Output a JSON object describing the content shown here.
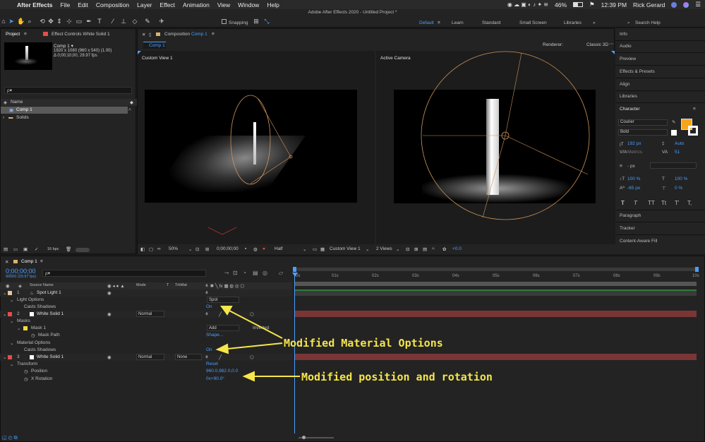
{
  "menubar": {
    "app_name": "After Effects",
    "items": [
      "File",
      "Edit",
      "Composition",
      "Layer",
      "Effect",
      "Animation",
      "View",
      "Window",
      "Help"
    ],
    "battery": "46%",
    "time": "12:39 PM",
    "user": "Rick Gerard"
  },
  "window_title": "Adobe After Effects 2020 - Untitled Project *",
  "toolbar": {
    "snapping_label": "Snapping",
    "workspaces": [
      "Default",
      "Learn",
      "Standard",
      "Small Screen",
      "Libraries"
    ],
    "active_workspace": "Default",
    "search_placeholder": "Search Help"
  },
  "project_panel": {
    "tab_project": "Project",
    "tab_effect_controls": "Effect Controls White Solid 1",
    "comp_name": "Comp 1 ▾",
    "comp_info_1": "1920 x 1080  (960 x 540) (1.00)",
    "comp_info_2": "Δ 0;00;10;00, 29.97 fps",
    "search_icon": "ρ▾",
    "col_name": "Name",
    "items": [
      "Comp 1",
      "Solids"
    ],
    "bpc": "16 bpc"
  },
  "comp_panel": {
    "tab": "Composition Comp 1",
    "tab_prefix": "Composition",
    "tab_comp": "Comp 1",
    "subtab": "Comp 1",
    "renderer_label": "Renderer:",
    "renderer_value": "Classic 3D",
    "view_left": "Custom View 1",
    "view_right": "Active Camera",
    "zoom": "50%",
    "timecode": "0;00;00;00",
    "resolution": "Half",
    "view_select": "Custom View 1",
    "views_count": "2 Views",
    "exposure": "+0.0"
  },
  "right_panel": {
    "items": [
      "Info",
      "Audio",
      "Preview",
      "Effects & Presets",
      "Align",
      "Libraries"
    ],
    "character_title": "Character",
    "font_family": "Courier",
    "font_style": "Bold",
    "font_size": "192 px",
    "leading": "Auto",
    "kerning": "Metrics",
    "tracking": "51",
    "stroke": "- px",
    "vscale": "100 %",
    "hscale": "100 %",
    "baseline": "-65 px",
    "tsume": "0 %",
    "text_styles": [
      "T",
      "T",
      "TT",
      "Tt",
      "T'",
      "T,"
    ],
    "bottom_items": [
      "Paragraph",
      "Tracker",
      "Content-Aware Fill"
    ],
    "fill_color": "#f7a51b"
  },
  "timeline": {
    "tab": "Comp 1",
    "timecode": "0;00;00;00",
    "fps_info": "00000 (29.97 fps)",
    "headers": {
      "source_name": "Source Name",
      "mode": "Mode",
      "t": "T",
      "trkmat": "TrkMat"
    },
    "ticks": [
      "0s",
      "01s",
      "02s",
      "03s",
      "04s",
      "05s",
      "06s",
      "07s",
      "08s",
      "09s",
      "10s"
    ],
    "rows": [
      {
        "num": "1",
        "name": "Spot Light 1",
        "label_color": "#e8c3a0"
      },
      {
        "name": "Light Options",
        "value": "Spot"
      },
      {
        "name": "Casts Shadows",
        "value": "On"
      },
      {
        "num": "2",
        "name": "White Solid 1",
        "mode": "Normal",
        "label_color": "#e94b4b"
      },
      {
        "name": "Masks"
      },
      {
        "name": "Mask 1",
        "mode": "Add",
        "value": "Inverted"
      },
      {
        "name": "Mask Path",
        "value": "Shape..."
      },
      {
        "name": "Material Options"
      },
      {
        "name": "Casts Shadows",
        "value": "On"
      },
      {
        "num": "3",
        "name": "White Solid 1",
        "mode": "Normal",
        "trkmat": "None",
        "label_color": "#e94b4b"
      },
      {
        "name": "Transform",
        "value": "Reset"
      },
      {
        "name": "Position",
        "value": "960.0,982.0,0.0"
      },
      {
        "name": "X Rotation",
        "value": "0x+90.0°"
      }
    ]
  },
  "annotations": {
    "material": "Modified Material Options",
    "position": "Modified position and rotation"
  }
}
